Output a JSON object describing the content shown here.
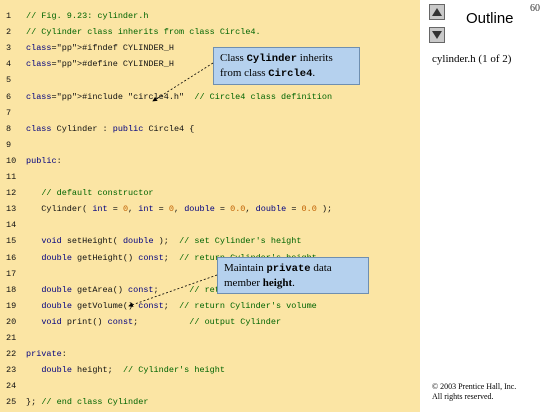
{
  "page_number": "60",
  "outline": {
    "title": "Outline",
    "file_label": "cylinder.h (1 of 2)",
    "nav": {
      "up": "up-arrow-icon",
      "down": "down-arrow-icon"
    }
  },
  "copyright": {
    "line1": "© 2003 Prentice Hall, Inc.",
    "line2": "All rights reserved."
  },
  "code_lines": [
    {
      "n": "1",
      "text": "// Fig. 9.23: cylinder.h"
    },
    {
      "n": "2",
      "text": "// Cylinder class inherits from class Circle4."
    },
    {
      "n": "3",
      "text": "#ifndef CYLINDER_H"
    },
    {
      "n": "4",
      "text": "#define CYLINDER_H"
    },
    {
      "n": "5",
      "text": ""
    },
    {
      "n": "6",
      "text": "#include \"circle4.h\"  // Circle4 class definition"
    },
    {
      "n": "7",
      "text": ""
    },
    {
      "n": "8",
      "text": "class Cylinder : public Circle4 {"
    },
    {
      "n": "9",
      "text": ""
    },
    {
      "n": "10",
      "text": "public:"
    },
    {
      "n": "11",
      "text": ""
    },
    {
      "n": "12",
      "text": "   // default constructor"
    },
    {
      "n": "13",
      "text": "   Cylinder( int = 0, int = 0, double = 0.0, double = 0.0 );"
    },
    {
      "n": "14",
      "text": ""
    },
    {
      "n": "15",
      "text": "   void setHeight( double );  // set Cylinder's height"
    },
    {
      "n": "16",
      "text": "   double getHeight() const;  // return Cylinder's height"
    },
    {
      "n": "17",
      "text": ""
    },
    {
      "n": "18",
      "text": "   double getArea() const;      // return Cylinder's area"
    },
    {
      "n": "19",
      "text": "   double getVolume() const;  // return Cylinder's volume"
    },
    {
      "n": "20",
      "text": "   void print() const;          // output Cylinder"
    },
    {
      "n": "21",
      "text": ""
    },
    {
      "n": "22",
      "text": "private:"
    },
    {
      "n": "23",
      "text": "   double height;  // Cylinder's height"
    },
    {
      "n": "24",
      "text": ""
    },
    {
      "n": "25",
      "text": "}; // end class Cylinder"
    }
  ],
  "callouts": {
    "inherit": {
      "line1_pre": "Class ",
      "line1_code": "Cylinder",
      "line1_post": " inherits",
      "line2_pre": "from class ",
      "line2_code": "Circle4",
      "line2_post": "."
    },
    "height": {
      "line1_pre": "Maintain ",
      "line1_code": "private",
      "line1_post": " data",
      "line2_pre": "member ",
      "line2_bold": "height",
      "line2_post": "."
    }
  },
  "colors": {
    "code_background": "#fbe5a4",
    "callout_background": "#b5d1ee",
    "comment": "#006400"
  }
}
